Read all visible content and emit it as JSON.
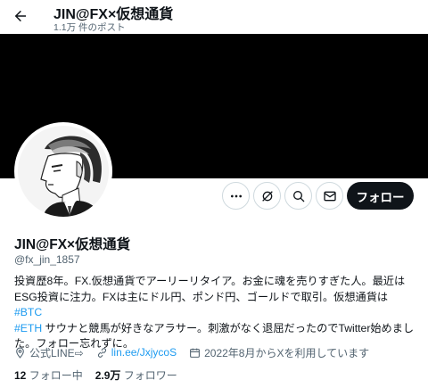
{
  "header": {
    "title": "JIN@FX×仮想通貨",
    "post_count": "1.1万 件のポスト",
    "back_icon": "arrow-left-icon"
  },
  "profile": {
    "display_name": "JIN@FX×仮想通貨",
    "handle": "@fx_jin_1857",
    "follow_label": "フォロー",
    "bio": {
      "line1": "投資歴8年。FX.仮想通貨でアーリーリタイア。お金に魂を売りすぎた人。最近はESG投資に注力。FXは主にドル円、ポンド円、ゴールドで取引。仮想通貨は ",
      "tag_btc": "#BTC",
      "tag_eth": "#ETH",
      "line2": " サウナと競馬が好きなアラサー。刺激がなく退屈だったのでTwitter始めました。フォロー忘れずに。"
    },
    "meta": {
      "location": "公式LINE⇨",
      "link": "lin.ee/JxjycoS",
      "joined": "2022年8月からXを利用しています"
    },
    "stats": {
      "following_count": "12",
      "following_label": "フォロー中",
      "followers_count": "2.9万",
      "followers_label": "フォロワー"
    }
  },
  "colors": {
    "accent": "#1d9bf0",
    "text": "#0f1419",
    "secondary": "#536471",
    "banner": "#000000",
    "follow_button": "#0f1419"
  }
}
